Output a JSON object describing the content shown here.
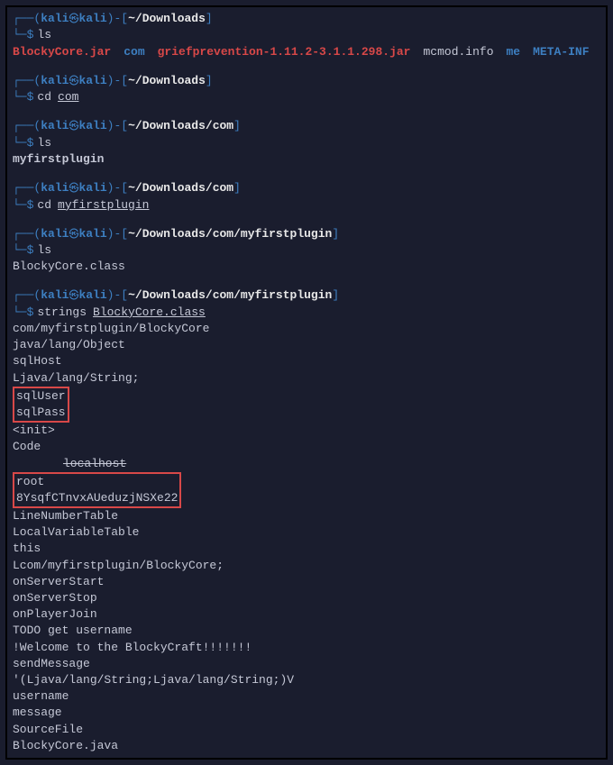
{
  "blocks": [
    {
      "user": "kali",
      "host": "kali",
      "path": "~/Downloads",
      "cmd": "ls",
      "argUnderline": "",
      "outputFiles": [
        {
          "name": "BlockyCore.jar",
          "cls": "file-red"
        },
        {
          "name": "com",
          "cls": "file-blue"
        },
        {
          "name": "griefprevention-1.11.2-3.1.1.298.jar",
          "cls": "file-red"
        },
        {
          "name": "mcmod.info",
          "cls": "file-white"
        },
        {
          "name": "me",
          "cls": "file-blue"
        },
        {
          "name": "META-INF",
          "cls": "file-blue"
        }
      ]
    },
    {
      "user": "kali",
      "host": "kali",
      "path": "~/Downloads",
      "cmd": "cd",
      "argUnderline": "com"
    },
    {
      "user": "kali",
      "host": "kali",
      "path": "~/Downloads/com",
      "cmd": "ls",
      "argUnderline": "",
      "outputBlue": "myfirstplugin"
    },
    {
      "user": "kali",
      "host": "kali",
      "path": "~/Downloads/com",
      "cmd": "cd",
      "argUnderline": "myfirstplugin"
    },
    {
      "user": "kali",
      "host": "kali",
      "path": "~/Downloads/com/myfirstplugin",
      "cmd": "ls",
      "argUnderline": "",
      "outputPlain": "BlockyCore.class"
    },
    {
      "user": "kali",
      "host": "kali",
      "path": "~/Downloads/com/myfirstplugin",
      "cmd": "strings",
      "argUnderline": "BlockyCore.class",
      "stringsOutput": {
        "pre1": [
          "com/myfirstplugin/BlockyCore",
          "java/lang/Object",
          "sqlHost",
          "Ljava/lang/String;"
        ],
        "box1": [
          "sqlUser",
          "sqlPass"
        ],
        "mid1": [
          "<init>",
          "Code"
        ],
        "strike1": "localhost",
        "box2": [
          "root",
          "8YsqfCTnvxAUeduzjNSXe22"
        ],
        "post1": [
          "LineNumberTable",
          "LocalVariableTable",
          "this",
          "Lcom/myfirstplugin/BlockyCore;",
          "onServerStart",
          "onServerStop",
          "onPlayerJoin",
          "TODO get username",
          "!Welcome to the BlockyCraft!!!!!!!",
          "sendMessage",
          "'(Ljava/lang/String;Ljava/lang/String;)V",
          "username",
          "message",
          "SourceFile",
          "BlockyCore.java"
        ]
      }
    }
  ]
}
